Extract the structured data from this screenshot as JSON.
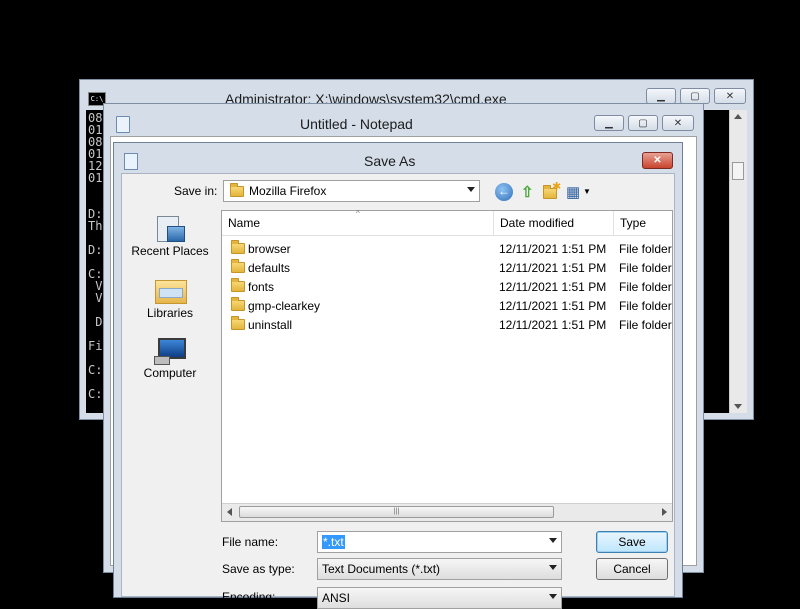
{
  "cmd": {
    "title": "Administrator: X:\\windows\\system32\\cmd.exe",
    "icon": "cmd-icon",
    "lines": [
      "08",
      "01",
      "08",
      "01",
      "12",
      "01",
      "",
      "",
      "D:",
      "Th",
      "",
      "D:",
      "",
      "C:",
      " V",
      " V",
      "",
      " D",
      "",
      "Fi",
      "",
      "C:",
      "",
      "C:"
    ]
  },
  "notepad": {
    "title": "Untitled - Notepad",
    "icon": "notepad-icon"
  },
  "dialog": {
    "title": "Save As",
    "save_in_label": "Save in:",
    "save_in_value": "Mozilla Firefox",
    "places": [
      {
        "label": "Recent Places",
        "icon": "recent-places-icon"
      },
      {
        "label": "Libraries",
        "icon": "libraries-icon"
      },
      {
        "label": "Computer",
        "icon": "computer-icon"
      }
    ],
    "columns": {
      "name": "Name",
      "date": "Date modified",
      "type": "Type"
    },
    "files": [
      {
        "name": "browser",
        "date": "12/11/2021 1:51 PM",
        "type": "File folder"
      },
      {
        "name": "defaults",
        "date": "12/11/2021 1:51 PM",
        "type": "File folder"
      },
      {
        "name": "fonts",
        "date": "12/11/2021 1:51 PM",
        "type": "File folder"
      },
      {
        "name": "gmp-clearkey",
        "date": "12/11/2021 1:51 PM",
        "type": "File folder"
      },
      {
        "name": "uninstall",
        "date": "12/11/2021 1:51 PM",
        "type": "File folder"
      }
    ],
    "file_name_label": "File name:",
    "file_name_value": "*.txt",
    "save_type_label": "Save as type:",
    "save_type_value": "Text Documents (*.txt)",
    "encoding_label": "Encoding:",
    "encoding_value": "ANSI",
    "save_button": "Save",
    "cancel_button": "Cancel",
    "close_glyph": "✕",
    "accent_color": "#3c7fb1"
  }
}
